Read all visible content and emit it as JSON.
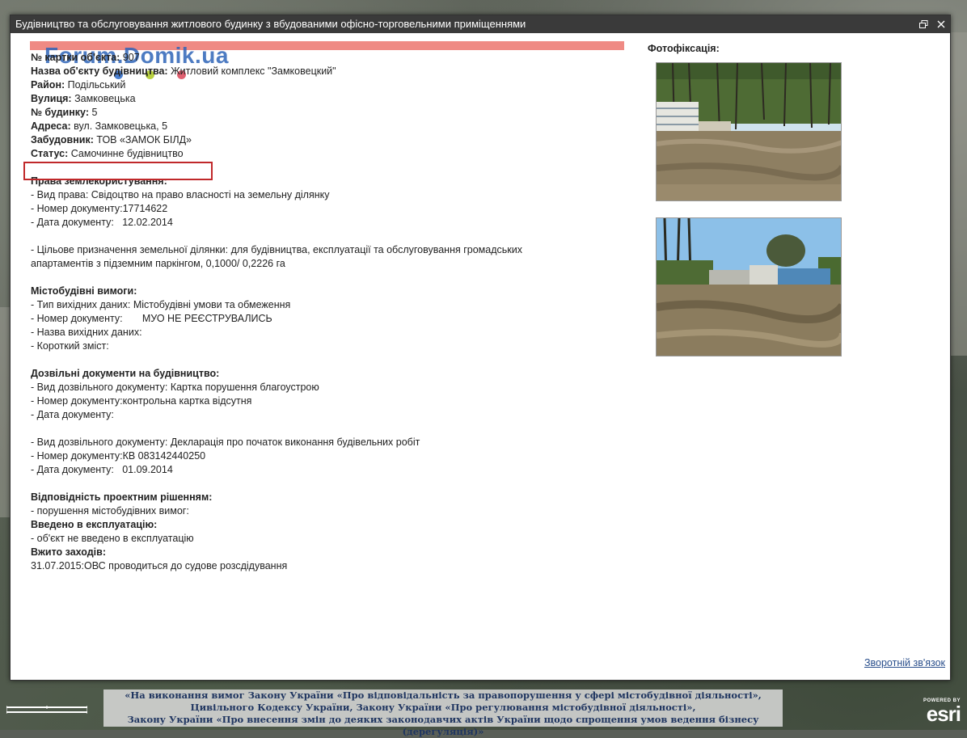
{
  "window": {
    "title": "Будівництво та обслуговування житлового будинку з вбудованими офісно-торговельними приміщеннями"
  },
  "watermark": "Forum.Domik.ua",
  "watermark_dot_colors": [
    "#4a7fd0",
    "#b8d040",
    "#e06070"
  ],
  "accent_bar_color": "#ef8a84",
  "status_highlight_color": "#c0282a",
  "card": {
    "lines": [
      {
        "label": "№ картки об'єкта:",
        "value": " 907"
      },
      {
        "label": "Назва об'єкту будівництва:",
        "value": " Житловий комплекс \"Замковецкий\""
      },
      {
        "label": "Район:",
        "value": " Подільський"
      },
      {
        "label": "Вулиця:",
        "value": " Замковецька"
      },
      {
        "label": "№ будинку:",
        "value": " 5"
      },
      {
        "label": "Адреса:",
        "value": " вул. Замковецька, 5"
      },
      {
        "label": "Забудовник:",
        "value": " ТОВ «ЗАМОК БІЛД»"
      },
      {
        "label": "Статус:",
        "value": " Самочинне будівництво"
      }
    ],
    "land": {
      "heading": "Права землекористування:",
      "rows": [
        "- Вид права: Свідоцтво на право власності на земельну ділянку",
        "- Номер документу:17714622",
        "- Дата документу:   12.02.2014"
      ],
      "purpose": [
        "- Цільове призначення земельної ділянки: для будівництва, експлуатації та обслуговування громадських",
        "апартаментів з підземним паркінгом, 0,1000/ 0,2226 га"
      ]
    },
    "urban": {
      "heading": "Містобудівні вимоги:",
      "rows": [
        "- Тип вихідних даних: Містобудівні умови та обмеження",
        "- Номер документу:       МУО НЕ РЕЄСТРУВАЛИСЬ",
        "- Назва вихідних даних:",
        "- Короткий зміст:"
      ]
    },
    "permits": {
      "heading": "Дозвільні документи на будівництво:",
      "group1": [
        "- Вид дозвільного документу: Картка порушення благоустрою",
        "- Номер документу:контрольна картка відсутня",
        "- Дата документу:"
      ],
      "group2": [
        "- Вид дозвільного документу: Декларація про початок виконання будівельних робіт",
        "- Номер документу:КВ 083142440250",
        "- Дата документу:   01.09.2014"
      ]
    },
    "compliance": {
      "heading": "Відповідність проектним рішенням:",
      "rows": [
        "- порушення містобудівних вимог:"
      ]
    },
    "commissioned": {
      "heading": "Введено в експлуатацію:",
      "rows": [
        "- об'єкт не введено в експлуатацію"
      ]
    },
    "measures": {
      "heading": "Вжито заходів:",
      "rows": [
        "31.07.2015:ОВС проводиться до судове розсдідування"
      ]
    }
  },
  "photos": {
    "title": "Фотофіксація:"
  },
  "feedback_link": "Зворотній зв'язок",
  "footer": {
    "lines": [
      "«На виконання вимог Закону України «Про відповідальність за правопорушення у сфері містобудівної діяльності»,",
      "Цивільного Кодексу України, Закону України «Про регулювання містобудівної діяльності»,",
      "Закону України «Про внесення змін до деяких законодавчих актів України щодо спрощення умов ведення бізнесу (дерегуляція)»"
    ]
  },
  "esri": {
    "powered_by": "POWERED BY",
    "logo": "esri"
  }
}
